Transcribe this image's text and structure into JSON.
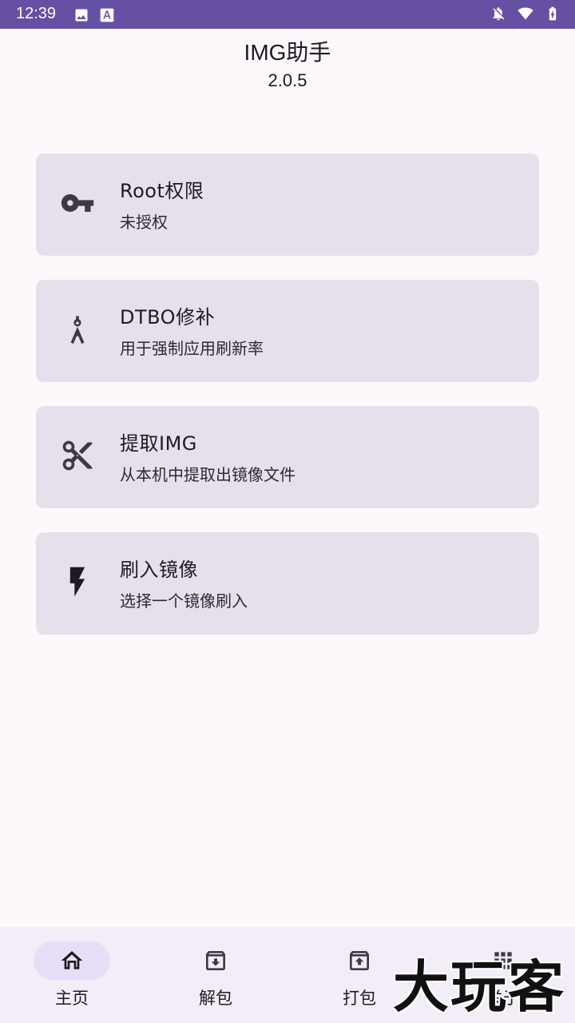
{
  "status_bar": {
    "time": "12:39",
    "left_icons": [
      "image-icon",
      "font-download-icon"
    ],
    "right_icons": [
      "notifications-off-icon",
      "wifi-icon",
      "battery-charging-icon"
    ]
  },
  "header": {
    "title": "IMG助手",
    "version": "2.0.5"
  },
  "cards": [
    {
      "icon": "key-icon",
      "title": "Root权限",
      "subtitle": "未授权"
    },
    {
      "icon": "compass-icon",
      "title": "DTBO修补",
      "subtitle": "用于强制应用刷新率"
    },
    {
      "icon": "scissors-icon",
      "title": "提取IMG",
      "subtitle": "从本机中提取出镜像文件"
    },
    {
      "icon": "flash-icon",
      "title": "刷入镜像",
      "subtitle": "选择一个镜像刷入"
    }
  ],
  "bottom_nav": {
    "items": [
      {
        "icon": "home-icon",
        "label": "主页",
        "active": true
      },
      {
        "icon": "unarchive-icon",
        "label": "解包",
        "active": false
      },
      {
        "icon": "archive-icon",
        "label": "打包",
        "active": false
      },
      {
        "icon": "apps-grid-icon",
        "label": "关于",
        "active": false
      }
    ]
  },
  "watermark": "大玩客",
  "colors": {
    "status_bar": "#6650a4",
    "background": "#fdf8fc",
    "card": "#e7e0ec",
    "nav_bar": "#f3edf7",
    "nav_active_pill": "#e8def8",
    "icon": "#3d3a44"
  }
}
